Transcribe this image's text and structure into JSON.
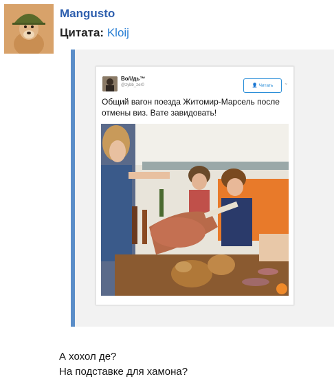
{
  "post": {
    "username": "Mangusto",
    "quote_label": "Цитата:",
    "quoted_user": "Kloij"
  },
  "tweet": {
    "display_name": "Во///дь™",
    "handle": "@zybb_zer0",
    "follow_label": "Читать",
    "text": "Общий вагон поезда Житомир-Марсель после отмены виз. Вате завидовать!"
  },
  "reply": {
    "line1": "А хохол де?",
    "line2": "На подставке для хамона?"
  },
  "colors": {
    "username": "#2e5fae",
    "link": "#2a7fd4",
    "quote_bar": "#5a8dc8",
    "quote_bg": "#f2f2f2",
    "follow_button": "#2a8ed8"
  },
  "icons": {
    "avatar": "dog-with-helmet-avatar",
    "follow": "add-person-icon",
    "menu": "chevron-down-icon"
  }
}
